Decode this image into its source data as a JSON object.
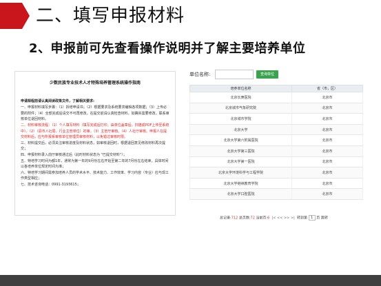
{
  "slide": {
    "title": "二、填写申报材料",
    "subtitle": "2、申报前可先查看操作说明并了解主要培养单位"
  },
  "doc": {
    "title": "少数民族专业技术人才特殊培养管理系统操作指南",
    "head": "申请规程前请认真阅读政策文件，了解相关要求:",
    "p1": "一、申报材料填写步骤：（1）拆增申请书；（2）根据要求及系统要求编辑各项数据；（3）上传必要的附件；（4）全部完成后请交不可再修改，在提交前请认真检查材料，如确实需要修改，联系审核单位退回材料。",
    "p2": "二、材料审核流程：（1）个人填写材料（填写完成后打印，由单位盖章后，扫描成PDF上传至系统中）。（2）（县市人社局、行业主管单位）初审。（3）主管厅审核。（4）人社厅审核。申报人在提交材料后，应与所报系审核单位管理员审核材料，以免错过审核时限。",
    "p3": "三、材料提交后，必须关注审核进度及材料状态，如审核退回时，根据退回意见修改材料再次提交；",
    "p4": "四、申报材料录入前厅审核通过后（此时材料状态为 \"已提交材料\"）；",
    "p5": "五、特培学习时间为都1年，通常为第一年的9月份左右开始至第二年的7月份左右结束，具体时间以各培养单位规定时间为准；",
    "p6": "六、特培学习期间需参加培养人员的学术水平、技术能力、工作效率、学习内容（专业）应与现工作类型相应；",
    "p7": "七、技术咨询电话：0991-3193615；"
  },
  "web": {
    "unit_label": "单位名称:",
    "input_value": "",
    "query_button": "查询单位",
    "columns": [
      "培养单位名称",
      "省（市，区）"
    ],
    "rows": [
      [
        "北京长庚医院",
        "北京市"
      ],
      [
        "北京城市气象研究院",
        "北京市"
      ],
      [
        "北京城市学院",
        "北京市"
      ],
      [
        "北京大学",
        "北京市"
      ],
      [
        "北京大学第六附属医院",
        "北京市"
      ],
      [
        "北京大学第三医院",
        "北京市"
      ],
      [
        "北京大学第一医院",
        "北京市"
      ],
      [
        "北京大学环境科学与工程学院",
        "北京市"
      ],
      [
        "北京大学继续教育学院",
        "北京市"
      ],
      [
        "北京大学口腔医院",
        "北京市"
      ]
    ],
    "pager": {
      "total_label": "总记录:",
      "total": "712",
      "pages_label": "总页数:",
      "pages": "72",
      "current_label": "当前页:",
      "current": "6",
      "nav": "|< << >> >|",
      "jump_label": "转到第",
      "jump_value": "1",
      "page_unit": "页",
      "go": "跳转"
    }
  },
  "colors": {
    "accent_red": "#c9161d",
    "button_green": "#3ba34f",
    "footer": "#3f3f3f"
  }
}
